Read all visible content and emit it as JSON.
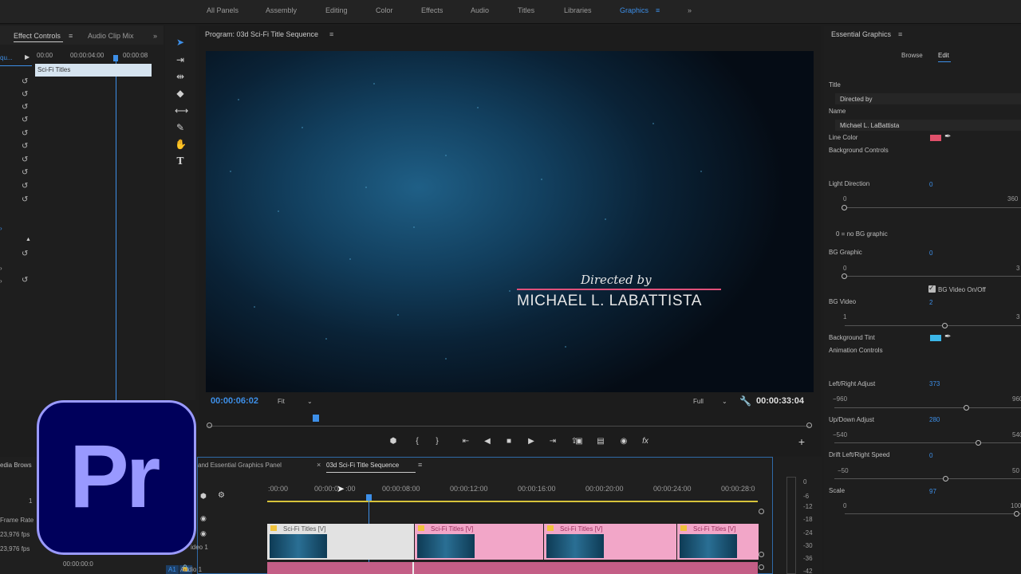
{
  "workspaces": [
    "All Panels",
    "Assembly",
    "Editing",
    "Color",
    "Effects",
    "Audio",
    "Titles",
    "Libraries",
    "Graphics"
  ],
  "active_workspace": "Graphics",
  "effect_controls": {
    "tab_label": "Effect Controls",
    "tab2_label": "Audio Clip Mix",
    "seq_short": "qu...",
    "time_start": "00:00",
    "time_mid": "00:00:04:00",
    "time_end": "00:00:08",
    "clip_name": "Sci-Fi Titles"
  },
  "program": {
    "title": "Program: 03d Sci-Fi Title Sequence",
    "overlay_line1": "Directed by",
    "overlay_line2": "MICHAEL L. LABATTISTA",
    "timecode_current": "00:00:06:02",
    "fit_label": "Fit",
    "quality_label": "Full",
    "timecode_duration": "00:00:33:04"
  },
  "essential_graphics": {
    "title": "Essential Graphics",
    "tab_browse": "Browse",
    "tab_edit": "Edit",
    "title_label": "Title",
    "title_value": "Directed by",
    "name_label": "Name",
    "name_value": "Michael L. LaBattista",
    "line_color_label": "Line Color",
    "line_color": "#e0506a",
    "bg_controls_label": "Background Controls",
    "light_direction_label": "Light Direction",
    "light_direction_value": "0",
    "light_min": "0",
    "light_max": "360",
    "no_bg_note": "0 = no BG graphic",
    "bg_graphic_label": "BG Graphic",
    "bg_graphic_value": "0",
    "bg_graphic_min": "0",
    "bg_graphic_max": "3",
    "bg_video_toggle_label": "BG Video On/Off",
    "bg_video_label": "BG Video",
    "bg_video_value": "2",
    "bg_video_min": "1",
    "bg_video_max": "3",
    "bg_tint_label": "Background Tint",
    "bg_tint_color": "#3bb6e8",
    "animation_label": "Animation Controls",
    "lr_label": "Left/Right Adjust",
    "lr_value": "373",
    "lr_min": "−960",
    "lr_max": "960",
    "ud_label": "Up/Down Adjust",
    "ud_value": "280",
    "ud_min": "−540",
    "ud_max": "540",
    "drift_label": "Drift Left/Right Speed",
    "drift_value": "0",
    "drift_min": "−50",
    "drift_max": "50",
    "scale_label": "Scale",
    "scale_value": "97",
    "scale_min": "0",
    "scale_max": "100"
  },
  "timeline": {
    "tab1_label": "and Essential Graphics Panel",
    "tab2_label": "03d Sci-Fi Title Sequence",
    "ruler": [
      ":00:00",
      "00:00:0",
      ":00",
      "00:00:08:00",
      "00:00:12:00",
      "00:00:16:00",
      "00:00:20:00",
      "00:00:24:00",
      "00:00:28:0"
    ],
    "clip_label": "Sci-Fi Titles [V]",
    "track_v1": "ideo 1",
    "track_a1": "Audio 1",
    "a1_badge": "A1"
  },
  "project": {
    "tab_label": "edia Brows",
    "frame_rate_label": "Frame Rate",
    "fps1": "23,976 fps",
    "fps2": "23,976 fps",
    "timecode": "00:00:00:0",
    "row_num": "1"
  },
  "meter": {
    "labels": [
      "0",
      "-6",
      "-12",
      "-18",
      "-24",
      "-30",
      "-36",
      "-42"
    ]
  },
  "logo_text": "Pr"
}
